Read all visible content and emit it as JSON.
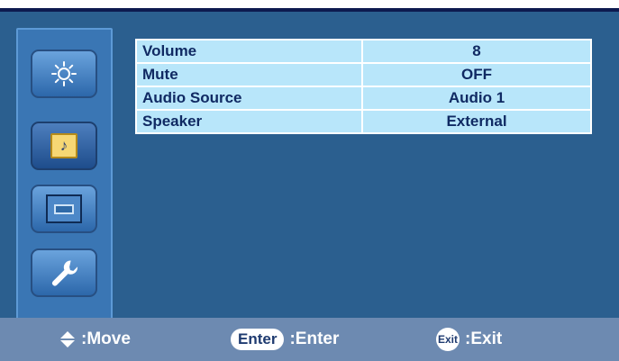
{
  "sidebar": {
    "items": [
      {
        "name": "picture",
        "icon": "sun-icon"
      },
      {
        "name": "audio",
        "icon": "music-note-icon",
        "selected": true
      },
      {
        "name": "display",
        "icon": "screen-icon"
      },
      {
        "name": "setup",
        "icon": "wrench-icon"
      }
    ]
  },
  "audio_menu": {
    "rows": [
      {
        "label": "Volume",
        "value": "8"
      },
      {
        "label": "Mute",
        "value": "OFF"
      },
      {
        "label": "Audio Source",
        "value": "Audio 1"
      },
      {
        "label": "Speaker",
        "value": "External"
      }
    ]
  },
  "footer": {
    "move_label": ":Move",
    "enter_key": "Enter",
    "enter_label": ":Enter",
    "exit_key": "Exit",
    "exit_label": ":Exit"
  },
  "colors": {
    "panel": "#2b5f8f",
    "cell": "#b8e6fa",
    "text": "#102a63",
    "footer": "#6d8ab1"
  }
}
